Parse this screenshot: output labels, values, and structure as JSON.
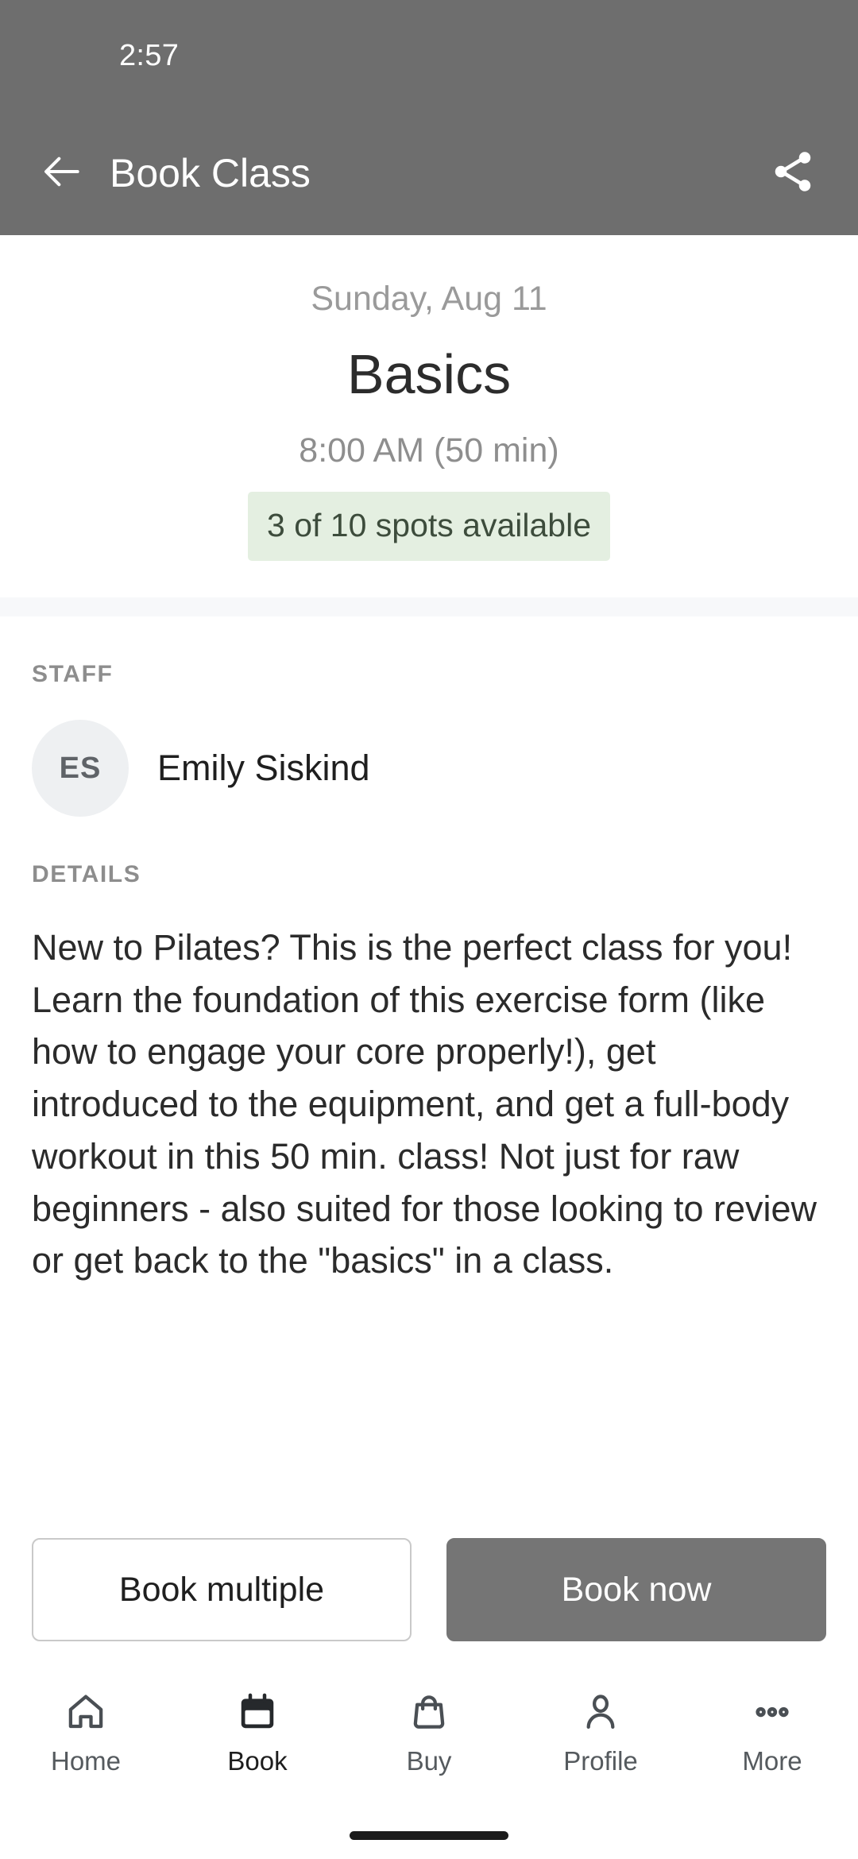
{
  "status_bar": {
    "clock": "2:57"
  },
  "app_bar": {
    "back_icon": "arrow-left-icon",
    "title": "Book Class",
    "share_icon": "share-icon"
  },
  "class": {
    "date": "Sunday, Aug 11",
    "name": "Basics",
    "time": "8:00 AM (50 min)",
    "spots": "3 of 10 spots available",
    "spots_badge_bg": "#e4efe1",
    "spots_badge_color": "#3d4c3c"
  },
  "staff": {
    "section_label": "STAFF",
    "avatar_initials": "ES",
    "name": "Emily Siskind"
  },
  "details": {
    "section_label": "DETAILS",
    "text": "New to Pilates? This is the perfect class for you! Learn the foundation of this exercise form (like how to engage your core properly!), get introduced to the equipment, and get a full-body workout in this 50 min. class! Not just for raw beginners - also suited for those looking to review or get back to the \"basics\" in a class."
  },
  "actions": {
    "book_multiple_label": "Book multiple",
    "book_now_label": "Book now",
    "primary_color": "#757575"
  },
  "bottom_nav": {
    "items": [
      {
        "label": "Home",
        "icon": "home-icon",
        "active": false
      },
      {
        "label": "Book",
        "icon": "calendar-icon",
        "active": true
      },
      {
        "label": "Buy",
        "icon": "bag-icon",
        "active": false
      },
      {
        "label": "Profile",
        "icon": "person-icon",
        "active": false
      },
      {
        "label": "More",
        "icon": "ellipsis-icon",
        "active": false
      }
    ]
  }
}
